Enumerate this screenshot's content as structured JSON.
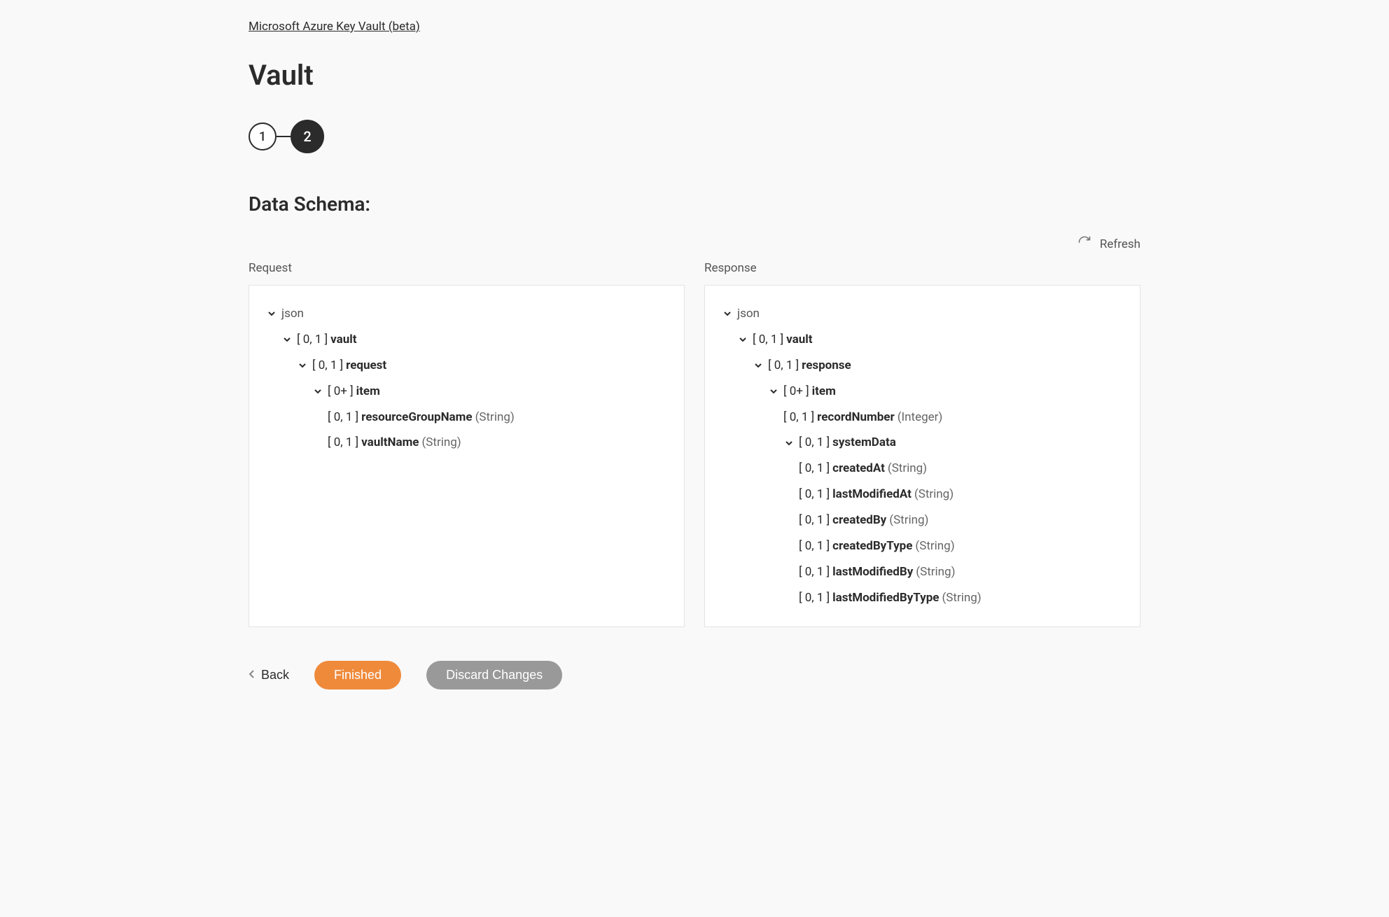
{
  "breadcrumb": "Microsoft Azure Key Vault (beta)",
  "page_title": "Vault",
  "stepper": {
    "step1": "1",
    "step2": "2"
  },
  "section_title": "Data Schema:",
  "refresh_label": "Refresh",
  "panels": {
    "request_label": "Request",
    "response_label": "Response"
  },
  "tree": {
    "root": "json",
    "request": {
      "vault": {
        "card": "[ 0, 1 ]",
        "name": "vault"
      },
      "req": {
        "card": "[ 0, 1 ]",
        "name": "request"
      },
      "item": {
        "card": "[ 0+ ]",
        "name": "item"
      },
      "resourceGroupName": {
        "card": "[ 0, 1 ]",
        "name": "resourceGroupName",
        "type": "(String)"
      },
      "vaultName": {
        "card": "[ 0, 1 ]",
        "name": "vaultName",
        "type": "(String)"
      }
    },
    "response": {
      "vault": {
        "card": "[ 0, 1 ]",
        "name": "vault"
      },
      "resp": {
        "card": "[ 0, 1 ]",
        "name": "response"
      },
      "item": {
        "card": "[ 0+ ]",
        "name": "item"
      },
      "recordNumber": {
        "card": "[ 0, 1 ]",
        "name": "recordNumber",
        "type": "(Integer)"
      },
      "systemData": {
        "card": "[ 0, 1 ]",
        "name": "systemData"
      },
      "createdAt": {
        "card": "[ 0, 1 ]",
        "name": "createdAt",
        "type": "(String)"
      },
      "lastModifiedAt": {
        "card": "[ 0, 1 ]",
        "name": "lastModifiedAt",
        "type": "(String)"
      },
      "createdBy": {
        "card": "[ 0, 1 ]",
        "name": "createdBy",
        "type": "(String)"
      },
      "createdByType": {
        "card": "[ 0, 1 ]",
        "name": "createdByType",
        "type": "(String)"
      },
      "lastModifiedBy": {
        "card": "[ 0, 1 ]",
        "name": "lastModifiedBy",
        "type": "(String)"
      },
      "lastModifiedByType": {
        "card": "[ 0, 1 ]",
        "name": "lastModifiedByType",
        "type": "(String)"
      }
    }
  },
  "actions": {
    "back": "Back",
    "finished": "Finished",
    "discard": "Discard Changes"
  }
}
